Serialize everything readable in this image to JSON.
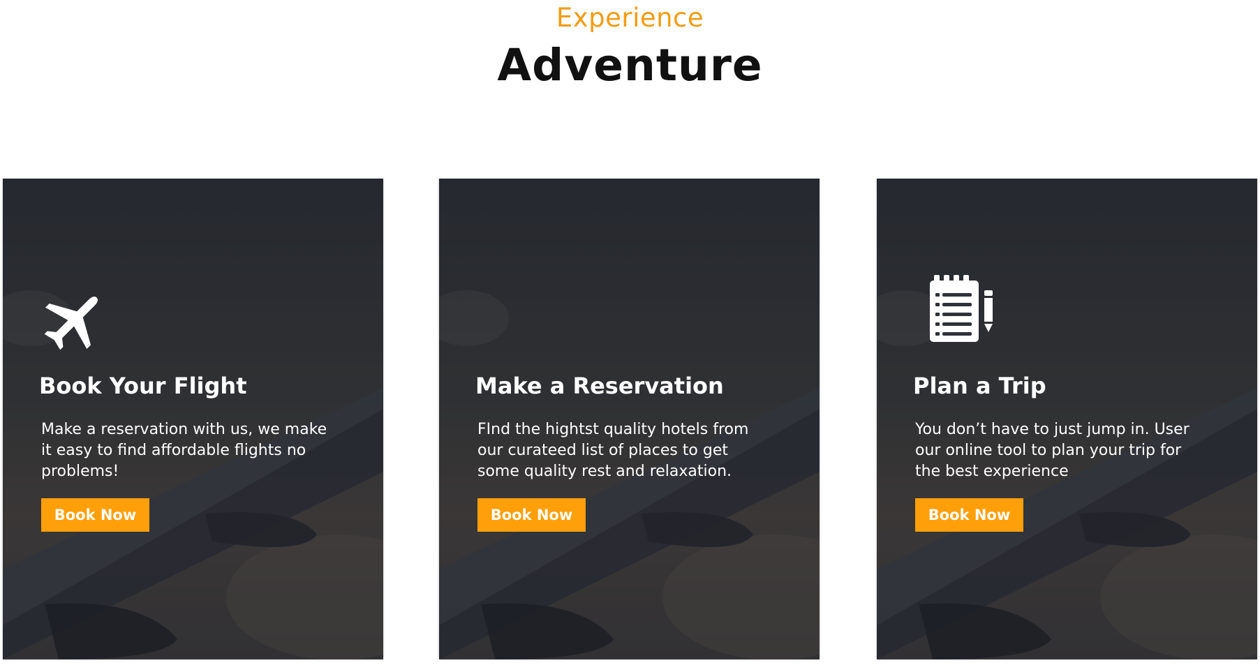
{
  "section": {
    "eyebrow": "Experience",
    "heading": "Adventure"
  },
  "colors": {
    "accent": "#ff9f0a",
    "eyebrow": "#f39c12",
    "card_overlay": "#2b2f36"
  },
  "cards": [
    {
      "icon": "airplane-icon",
      "title": "Book Your Flight",
      "text": "Make a reservation with us, we make it easy to find affordable flights no problems!",
      "button_label": "Book Now"
    },
    {
      "icon": "none",
      "title": "Make a Reservation",
      "text": "FInd the hightst quality hotels from our curateed list of places to get some quality rest and relaxation.",
      "button_label": "Book Now"
    },
    {
      "icon": "notepad-pencil-icon",
      "title": "Plan a Trip",
      "text": "You don’t have to just jump in. User our online tool to plan your trip for the best experience",
      "button_label": "Book Now"
    }
  ]
}
